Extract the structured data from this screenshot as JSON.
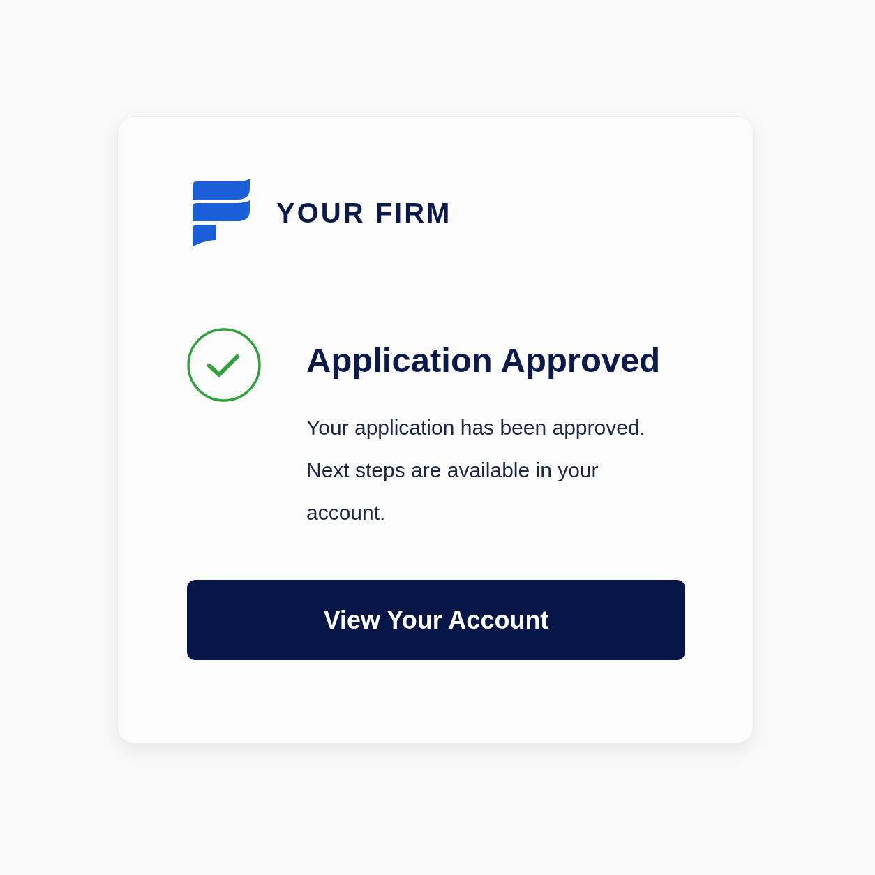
{
  "logo": {
    "text": "YOUR FIRM"
  },
  "status": {
    "title": "Application Approved",
    "message": [
      "Your application has been approved.",
      "Next steps are available in your account."
    ]
  },
  "button": {
    "label": "View Your Account"
  }
}
